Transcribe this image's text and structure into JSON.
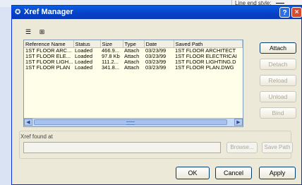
{
  "background": {
    "line_end_style_label": "Line end style:"
  },
  "dialog": {
    "title": "Xref Manager",
    "help_label": "?",
    "close_label": "×"
  },
  "view_buttons": [
    {
      "name": "list-view",
      "glyph": "☰"
    },
    {
      "name": "tree-view",
      "glyph": "⊞"
    }
  ],
  "table": {
    "columns": [
      "Reference Name",
      "Status",
      "Size",
      "Type",
      "Date",
      "Saved Path"
    ],
    "rows": [
      [
        "1ST FLOOR ARC...",
        "Loaded",
        "466.9...",
        "Attach",
        "03/23/99",
        "1ST FLOOR ARCHITECT"
      ],
      [
        "1ST FLOOR ELE...",
        "Loaded",
        "97.8 Kb",
        "Attach",
        "03/23/99",
        "1ST FLOOR ELECTRICAI"
      ],
      [
        "1ST FLOOR LIGH...",
        "Loaded",
        "111.2...",
        "Attach",
        "03/23/99",
        "1ST FLOOR LIGHTING.D"
      ],
      [
        "1ST FLOOR PLAN",
        "Loaded",
        "341.8...",
        "Attach",
        "03/23/99",
        "1ST FLOOR PLAN.DWG"
      ]
    ]
  },
  "side_buttons": {
    "attach": "Attach",
    "detach": "Detach",
    "reload": "Reload",
    "unload": "Unload",
    "bind": "Bind"
  },
  "found_at": {
    "label": "Xref found at",
    "value": "",
    "browse": "Browse...",
    "save_path": "Save Path"
  },
  "footer": {
    "ok": "OK",
    "cancel": "Cancel",
    "apply": "Apply"
  }
}
